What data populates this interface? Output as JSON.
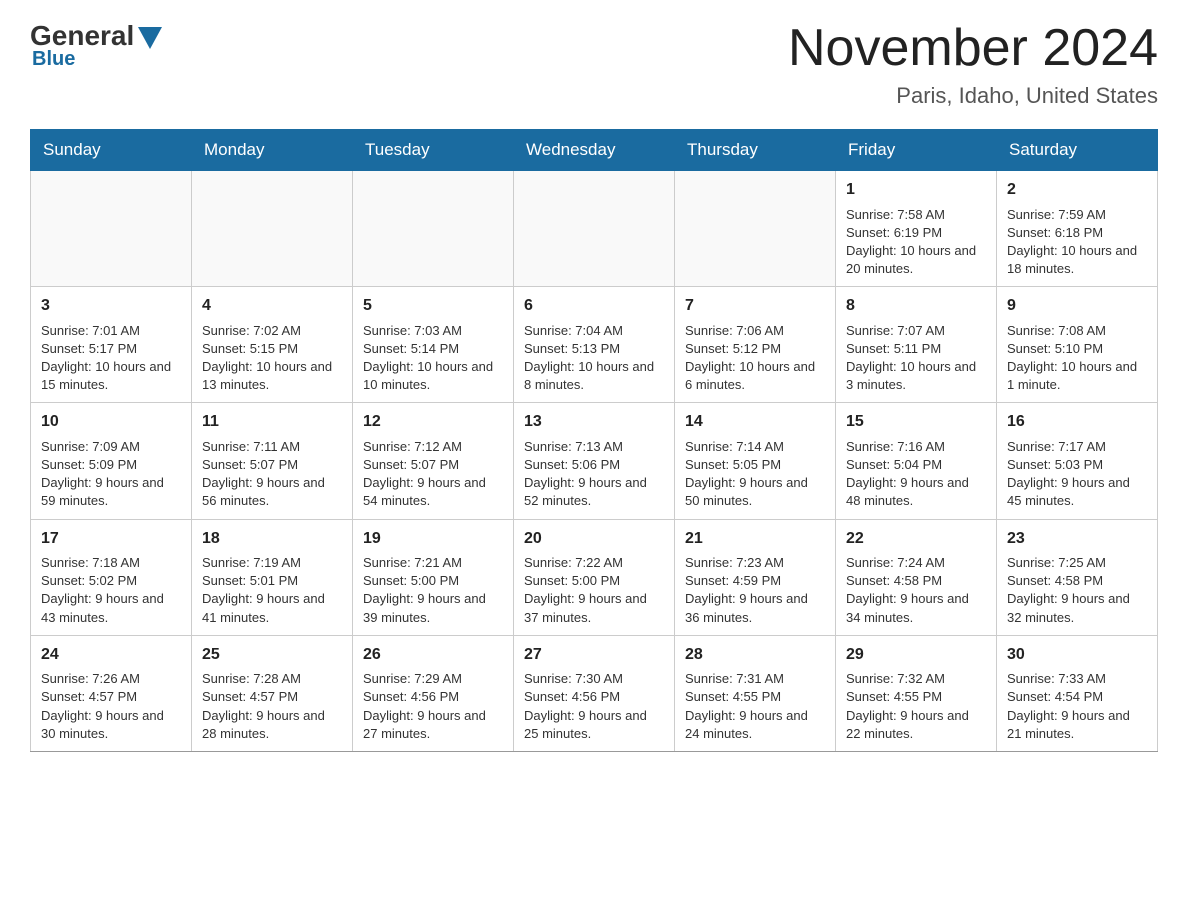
{
  "header": {
    "logo_general": "General",
    "logo_blue": "Blue",
    "month_title": "November 2024",
    "location": "Paris, Idaho, United States"
  },
  "weekdays": [
    "Sunday",
    "Monday",
    "Tuesday",
    "Wednesday",
    "Thursday",
    "Friday",
    "Saturday"
  ],
  "weeks": [
    [
      {
        "day": "",
        "info": ""
      },
      {
        "day": "",
        "info": ""
      },
      {
        "day": "",
        "info": ""
      },
      {
        "day": "",
        "info": ""
      },
      {
        "day": "",
        "info": ""
      },
      {
        "day": "1",
        "info": "Sunrise: 7:58 AM\nSunset: 6:19 PM\nDaylight: 10 hours and 20 minutes."
      },
      {
        "day": "2",
        "info": "Sunrise: 7:59 AM\nSunset: 6:18 PM\nDaylight: 10 hours and 18 minutes."
      }
    ],
    [
      {
        "day": "3",
        "info": "Sunrise: 7:01 AM\nSunset: 5:17 PM\nDaylight: 10 hours and 15 minutes."
      },
      {
        "day": "4",
        "info": "Sunrise: 7:02 AM\nSunset: 5:15 PM\nDaylight: 10 hours and 13 minutes."
      },
      {
        "day": "5",
        "info": "Sunrise: 7:03 AM\nSunset: 5:14 PM\nDaylight: 10 hours and 10 minutes."
      },
      {
        "day": "6",
        "info": "Sunrise: 7:04 AM\nSunset: 5:13 PM\nDaylight: 10 hours and 8 minutes."
      },
      {
        "day": "7",
        "info": "Sunrise: 7:06 AM\nSunset: 5:12 PM\nDaylight: 10 hours and 6 minutes."
      },
      {
        "day": "8",
        "info": "Sunrise: 7:07 AM\nSunset: 5:11 PM\nDaylight: 10 hours and 3 minutes."
      },
      {
        "day": "9",
        "info": "Sunrise: 7:08 AM\nSunset: 5:10 PM\nDaylight: 10 hours and 1 minute."
      }
    ],
    [
      {
        "day": "10",
        "info": "Sunrise: 7:09 AM\nSunset: 5:09 PM\nDaylight: 9 hours and 59 minutes."
      },
      {
        "day": "11",
        "info": "Sunrise: 7:11 AM\nSunset: 5:07 PM\nDaylight: 9 hours and 56 minutes."
      },
      {
        "day": "12",
        "info": "Sunrise: 7:12 AM\nSunset: 5:07 PM\nDaylight: 9 hours and 54 minutes."
      },
      {
        "day": "13",
        "info": "Sunrise: 7:13 AM\nSunset: 5:06 PM\nDaylight: 9 hours and 52 minutes."
      },
      {
        "day": "14",
        "info": "Sunrise: 7:14 AM\nSunset: 5:05 PM\nDaylight: 9 hours and 50 minutes."
      },
      {
        "day": "15",
        "info": "Sunrise: 7:16 AM\nSunset: 5:04 PM\nDaylight: 9 hours and 48 minutes."
      },
      {
        "day": "16",
        "info": "Sunrise: 7:17 AM\nSunset: 5:03 PM\nDaylight: 9 hours and 45 minutes."
      }
    ],
    [
      {
        "day": "17",
        "info": "Sunrise: 7:18 AM\nSunset: 5:02 PM\nDaylight: 9 hours and 43 minutes."
      },
      {
        "day": "18",
        "info": "Sunrise: 7:19 AM\nSunset: 5:01 PM\nDaylight: 9 hours and 41 minutes."
      },
      {
        "day": "19",
        "info": "Sunrise: 7:21 AM\nSunset: 5:00 PM\nDaylight: 9 hours and 39 minutes."
      },
      {
        "day": "20",
        "info": "Sunrise: 7:22 AM\nSunset: 5:00 PM\nDaylight: 9 hours and 37 minutes."
      },
      {
        "day": "21",
        "info": "Sunrise: 7:23 AM\nSunset: 4:59 PM\nDaylight: 9 hours and 36 minutes."
      },
      {
        "day": "22",
        "info": "Sunrise: 7:24 AM\nSunset: 4:58 PM\nDaylight: 9 hours and 34 minutes."
      },
      {
        "day": "23",
        "info": "Sunrise: 7:25 AM\nSunset: 4:58 PM\nDaylight: 9 hours and 32 minutes."
      }
    ],
    [
      {
        "day": "24",
        "info": "Sunrise: 7:26 AM\nSunset: 4:57 PM\nDaylight: 9 hours and 30 minutes."
      },
      {
        "day": "25",
        "info": "Sunrise: 7:28 AM\nSunset: 4:57 PM\nDaylight: 9 hours and 28 minutes."
      },
      {
        "day": "26",
        "info": "Sunrise: 7:29 AM\nSunset: 4:56 PM\nDaylight: 9 hours and 27 minutes."
      },
      {
        "day": "27",
        "info": "Sunrise: 7:30 AM\nSunset: 4:56 PM\nDaylight: 9 hours and 25 minutes."
      },
      {
        "day": "28",
        "info": "Sunrise: 7:31 AM\nSunset: 4:55 PM\nDaylight: 9 hours and 24 minutes."
      },
      {
        "day": "29",
        "info": "Sunrise: 7:32 AM\nSunset: 4:55 PM\nDaylight: 9 hours and 22 minutes."
      },
      {
        "day": "30",
        "info": "Sunrise: 7:33 AM\nSunset: 4:54 PM\nDaylight: 9 hours and 21 minutes."
      }
    ]
  ]
}
